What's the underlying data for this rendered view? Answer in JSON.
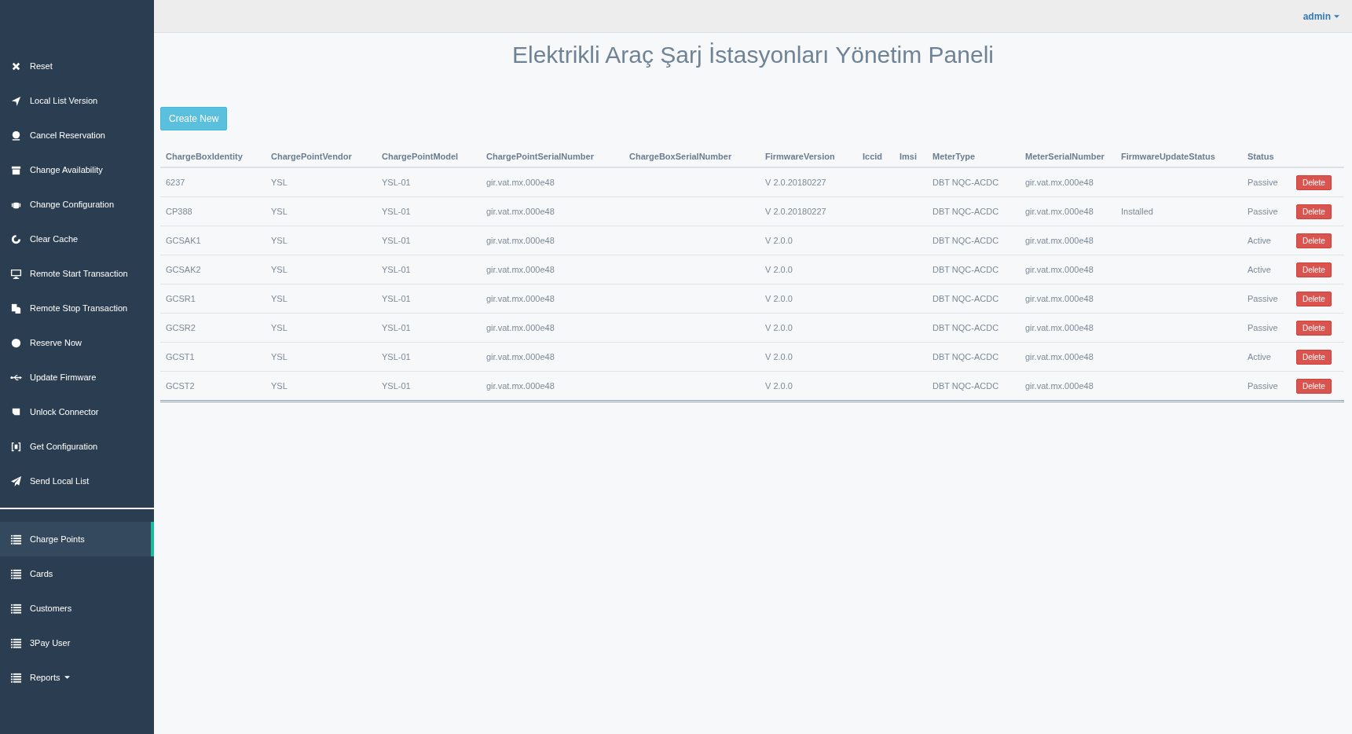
{
  "sidebar": {
    "actions": [
      {
        "label": "Reset"
      },
      {
        "label": "Local List Version"
      },
      {
        "label": "Cancel Reservation"
      },
      {
        "label": "Change Availability"
      },
      {
        "label": "Change Configuration"
      },
      {
        "label": "Clear Cache"
      },
      {
        "label": "Remote Start Transaction"
      },
      {
        "label": "Remote Stop Transaction"
      },
      {
        "label": "Reserve Now"
      },
      {
        "label": "Update Firmware"
      },
      {
        "label": "Unlock Connector"
      },
      {
        "label": "Get Configuration"
      },
      {
        "label": "Send Local List"
      }
    ],
    "nav": [
      {
        "label": "Charge Points",
        "selected": true,
        "dropdown": false
      },
      {
        "label": "Cards",
        "selected": false,
        "dropdown": false
      },
      {
        "label": "Customers",
        "selected": false,
        "dropdown": false
      },
      {
        "label": "3Pay User",
        "selected": false,
        "dropdown": false
      },
      {
        "label": "Reports",
        "selected": false,
        "dropdown": true
      }
    ]
  },
  "top_bar": {
    "user": "admin"
  },
  "title": "Elektrikli Araç Şarj İstasyonları Yönetim Paneli",
  "create_button": "Create New",
  "table": {
    "columns": [
      "ChargeBoxIdentity",
      "ChargePointVendor",
      "ChargePointModel",
      "ChargePointSerialNumber",
      "ChargeBoxSerialNumber",
      "FirmwareVersion",
      "Iccid",
      "Imsi",
      "MeterType",
      "MeterSerialNumber",
      "FirmwareUpdateStatus",
      "Status"
    ],
    "rows": [
      {
        "cells": [
          "6237",
          "YSL",
          "YSL-01",
          "gir.vat.mx.000e48",
          "",
          "V 2.0.20180227",
          "",
          "",
          "DBT NQC-ACDC",
          "gir.vat.mx.000e48",
          "",
          "Passive"
        ],
        "action": "Delete"
      },
      {
        "cells": [
          "CP388",
          "YSL",
          "YSL-01",
          "gir.vat.mx.000e48",
          "",
          "V 2.0.20180227",
          "",
          "",
          "DBT NQC-ACDC",
          "gir.vat.mx.000e48",
          "Installed",
          "Passive"
        ],
        "action": "Delete"
      },
      {
        "cells": [
          "GCSAK1",
          "YSL",
          "YSL-01",
          "gir.vat.mx.000e48",
          "",
          "V 2.0.0",
          "",
          "",
          "DBT NQC-ACDC",
          "gir.vat.mx.000e48",
          "",
          "Active"
        ],
        "action": "Delete"
      },
      {
        "cells": [
          "GCSAK2",
          "YSL",
          "YSL-01",
          "gir.vat.mx.000e48",
          "",
          "V 2.0.0",
          "",
          "",
          "DBT NQC-ACDC",
          "gir.vat.mx.000e48",
          "",
          "Active"
        ],
        "action": "Delete"
      },
      {
        "cells": [
          "GCSR1",
          "YSL",
          "YSL-01",
          "gir.vat.mx.000e48",
          "",
          "V 2.0.0",
          "",
          "",
          "DBT NQC-ACDC",
          "gir.vat.mx.000e48",
          "",
          "Passive"
        ],
        "action": "Delete"
      },
      {
        "cells": [
          "GCSR2",
          "YSL",
          "YSL-01",
          "gir.vat.mx.000e48",
          "",
          "V 2.0.0",
          "",
          "",
          "DBT NQC-ACDC",
          "gir.vat.mx.000e48",
          "",
          "Passive"
        ],
        "action": "Delete"
      },
      {
        "cells": [
          "GCST1",
          "YSL",
          "YSL-01",
          "gir.vat.mx.000e48",
          "",
          "V 2.0.0",
          "",
          "",
          "DBT NQC-ACDC",
          "gir.vat.mx.000e48",
          "",
          "Active"
        ],
        "action": "Delete"
      },
      {
        "cells": [
          "GCST2",
          "YSL",
          "YSL-01",
          "gir.vat.mx.000e48",
          "",
          "V 2.0.0",
          "",
          "",
          "DBT NQC-ACDC",
          "gir.vat.mx.000e48",
          "",
          "Passive"
        ],
        "action": "Delete"
      }
    ]
  }
}
